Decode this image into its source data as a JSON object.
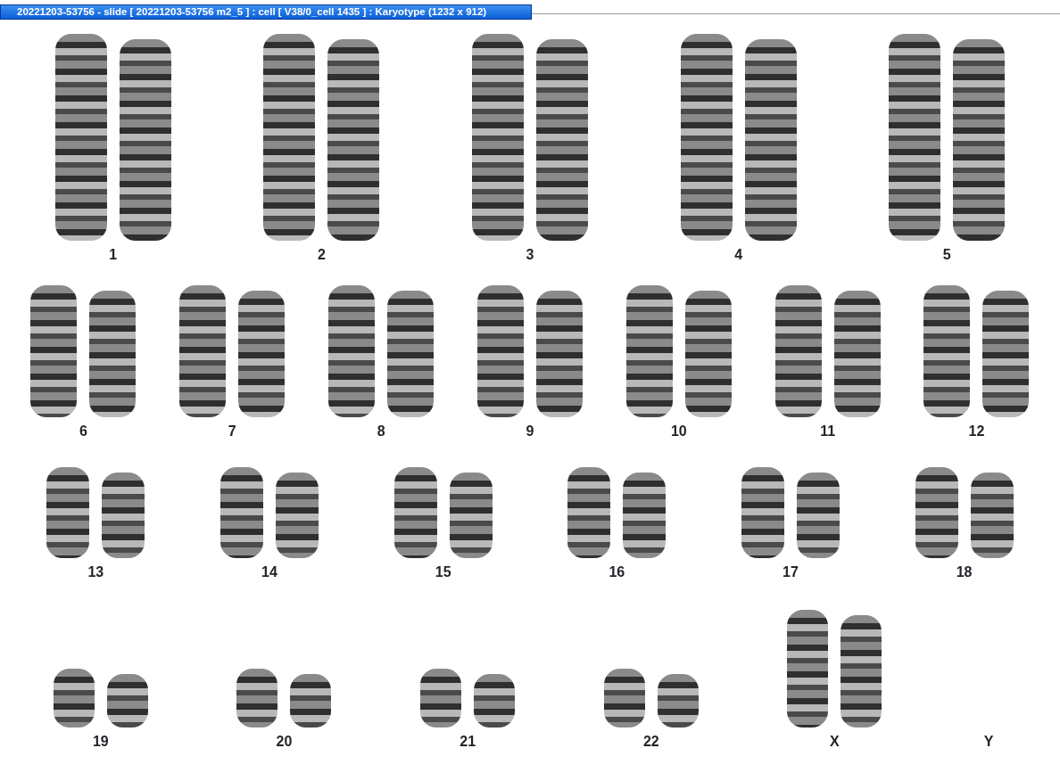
{
  "window": {
    "title": "20221203-53756 - slide [ 20221203-53756 m2_5 ] : cell [ V38/0_cell 1435 ] : Karyotype  (1232 x 912)"
  },
  "rows": [
    {
      "groups": [
        {
          "label": "1",
          "kind": "pair"
        },
        {
          "label": "2",
          "kind": "pair"
        },
        {
          "label": "3",
          "kind": "pair"
        },
        {
          "label": "4",
          "kind": "pair"
        },
        {
          "label": "5",
          "kind": "pair"
        }
      ]
    },
    {
      "groups": [
        {
          "label": "6",
          "kind": "pair"
        },
        {
          "label": "7",
          "kind": "pair"
        },
        {
          "label": "8",
          "kind": "pair"
        },
        {
          "label": "9",
          "kind": "pair"
        },
        {
          "label": "10",
          "kind": "pair"
        },
        {
          "label": "11",
          "kind": "pair"
        },
        {
          "label": "12",
          "kind": "pair"
        }
      ]
    },
    {
      "groups": [
        {
          "label": "13",
          "kind": "pair"
        },
        {
          "label": "14",
          "kind": "pair"
        },
        {
          "label": "15",
          "kind": "pair"
        },
        {
          "label": "16",
          "kind": "pair"
        },
        {
          "label": "17",
          "kind": "pair"
        },
        {
          "label": "18",
          "kind": "pair"
        }
      ]
    },
    {
      "groups": [
        {
          "label": "19",
          "kind": "pair"
        },
        {
          "label": "20",
          "kind": "pair"
        },
        {
          "label": "21",
          "kind": "pair"
        },
        {
          "label": "22",
          "kind": "pair"
        },
        {
          "label": "X",
          "kind": "tall-pair"
        },
        {
          "label": "Y",
          "kind": "empty"
        }
      ]
    }
  ]
}
